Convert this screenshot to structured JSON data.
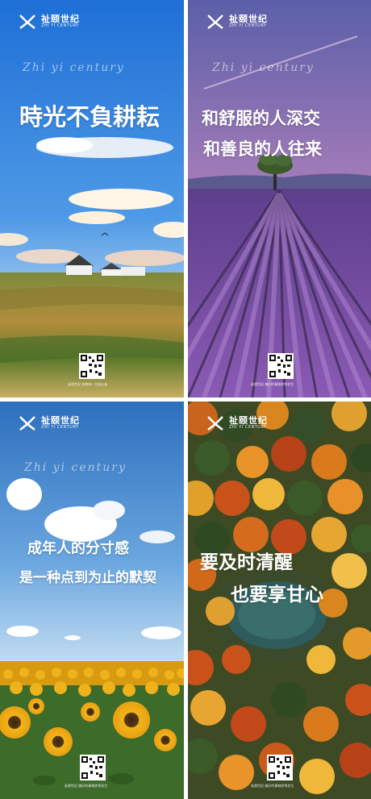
{
  "brand": {
    "name": "祉颐世纪",
    "sub": "ZHI YI CENTURY"
  },
  "posters": [
    {
      "script_text": "Zhi yi century",
      "headline_lines": [
        "時光不負耕耘"
      ],
      "tagline": "祉颐世纪 致敬每一位奋斗者",
      "scene": "summer-field-houses"
    },
    {
      "script_text": "Zhi yi century",
      "headline_lines": [
        "和舒服的人深交",
        "和善良的人往来"
      ],
      "tagline": "祉颐世纪 美好的事物即将发生",
      "scene": "lavender-field-tree"
    },
    {
      "script_text": "Zhi yi century",
      "headline_lines": [
        "成年人的分寸感",
        "是一种点到为止的默契"
      ],
      "tagline": "祉颐世纪 美好的事物即将发生",
      "scene": "sunflower-field-sky"
    },
    {
      "script_text": "",
      "headline_lines": [
        "要及时清醒",
        "也要享甘心"
      ],
      "tagline": "祉颐世纪 美好的事物即将发生",
      "scene": "autumn-forest-lake"
    }
  ]
}
